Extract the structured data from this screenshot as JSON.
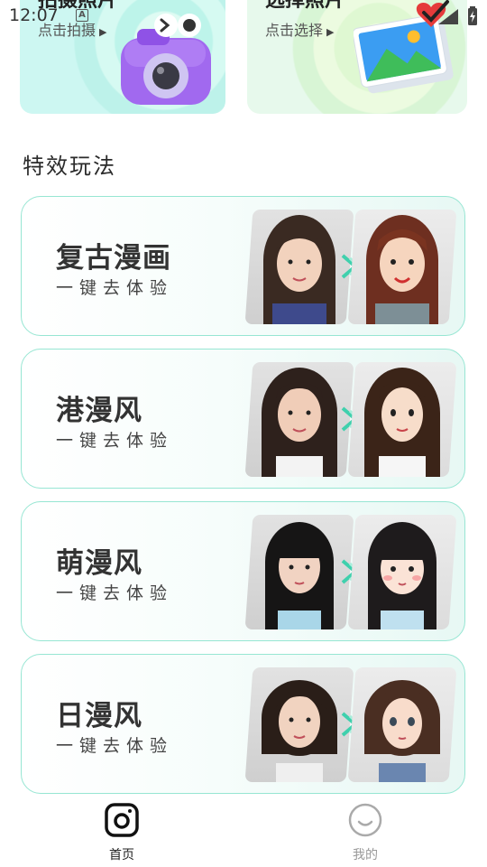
{
  "status_bar": {
    "time": "12:07",
    "a_icon": "A"
  },
  "top_cards": [
    {
      "title": "拍摄照片",
      "subtitle": "点击拍摄",
      "icon": "camera-icon",
      "accent": "#c5f3ee"
    },
    {
      "title": "选择照片",
      "subtitle": "点击选择",
      "icon": "gallery-icon",
      "accent": "#e2f7e4"
    }
  ],
  "section_title": "特效玩法",
  "effects": [
    {
      "title": "复古漫画",
      "cta": "一键去体验"
    },
    {
      "title": "港漫风",
      "cta": "一键去体验"
    },
    {
      "title": "萌漫风",
      "cta": "一键去体验"
    },
    {
      "title": "日漫风",
      "cta": "一键去体验"
    }
  ],
  "bottom_nav": {
    "items": [
      {
        "label": "首页",
        "icon": "camera-square-icon",
        "active": true
      },
      {
        "label": "我的",
        "icon": "smile-icon",
        "active": false
      }
    ]
  },
  "colors": {
    "accent": "#97e6d3",
    "arrow": "#3fd0ad"
  }
}
